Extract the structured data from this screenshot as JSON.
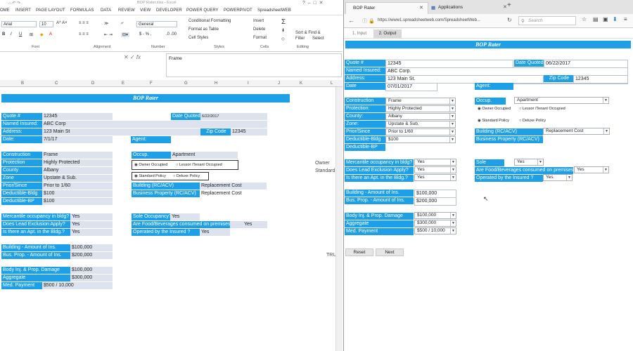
{
  "excel": {
    "title_center": "BOP Rater.xlsx - Excel",
    "tabs": [
      "OME",
      "INSERT",
      "PAGE LAYOUT",
      "FORMULAS",
      "DATA",
      "REVIEW",
      "VIEW",
      "DEVELOPER",
      "POWER QUERY",
      "POWERPIVOT",
      "SpreadsheetWEB"
    ],
    "font_name": "Arial",
    "font_size": "10",
    "number_format": "General",
    "styles_items": [
      "Conditional Formatting",
      "Format as Table",
      "Cell Styles"
    ],
    "cells_items": [
      "Insert",
      "Delete",
      "Format"
    ],
    "editing_items": [
      "Sort & Find &",
      "Filter",
      "Select"
    ],
    "groups": [
      "Font",
      "Alignment",
      "Number",
      "Styles",
      "Cells",
      "Editing"
    ],
    "formula_value": "Frame",
    "columns": [
      "B",
      "C",
      "D",
      "E",
      "F",
      "G",
      "H",
      "I",
      "J",
      "K",
      "L"
    ],
    "sheet_title": "BOP Rater",
    "quote_label": "Quote #",
    "quote_value": "12345",
    "date_quoted_label": "Date Quoted",
    "date_quoted_value": "6/22/2017",
    "named_insured_label": "Named Insured:",
    "named_insured_value": "ABC Corp",
    "address_label": "Address:",
    "address_value": "123 Main St",
    "zip_label": "Zip Code",
    "zip_value": "12345",
    "date_label": "Date:",
    "date_value": "7/1/17",
    "agent_label": "Agent:",
    "construction_label": "Construction",
    "construction_value": "Frame",
    "protection_label": "Protection",
    "protection_value": "Highly Protected",
    "county_label": "County",
    "county_value": "Albany",
    "zone_label": "Zone",
    "zone_value": "Upstate & Sub.",
    "prior_since_label": "Prior/Since",
    "prior_since_value": "Prior to 1/60",
    "deductible_bldg_label": "Deductible-Bldg",
    "deductible_bldg_value": "$100",
    "deductible_bp_label": "Deductible-BP",
    "deductible_bp_value": "$100",
    "occup_label": "Occup.",
    "occup_value": "Apartment",
    "owner_occupied": "Owner Occupied",
    "lessor_tenant": "Lessor /Tenant Occupied",
    "standard_policy": "Standard Policy",
    "deluxe_policy": "Deluxe Policy",
    "building_rcacv_label": "Building (RC/ACV)",
    "building_rcacv_value": "Replacement Cost",
    "bp_rcacv_label": "Business Property (RC/ACV)",
    "bp_rcacv_value": "Replacement Cost",
    "side_owner": "Owner",
    "side_standard": "Standard",
    "mercantile_label": "Mercantile occupancy in bldg?",
    "mercantile_value": "Yes",
    "lead_label": "Does Lead Exclusion Apply?",
    "lead_value": "Yes",
    "apt_label": "Is there an Apt. in the Bldg.?",
    "apt_value": "Yes",
    "sole_label": "Sole Occupancy?",
    "sole_value": "Yes",
    "food_label": "Are Food/Beverages consumed on premises?",
    "food_value": "Yes",
    "operated_label": "Operated by the Insured ?",
    "operated_value": "Yes",
    "building_amt_label": "Building - Amount of Ins.",
    "building_amt_value": "$100,000",
    "bus_prop_label": "Bus. Prop. - Amount of Ins.",
    "bus_prop_value": "$200,000",
    "tru_text": "TRU",
    "bi_label": "Body Inj. & Prop. Damage",
    "bi_value": "$100,000",
    "aggregate_label": "Aggregate",
    "aggregate_value": "$300,000",
    "med_label": "Med. Payment",
    "med_value": "$500 / 10,000"
  },
  "browser": {
    "tab1": "BOP Rater",
    "tab2": "Applications",
    "new_tab": "+",
    "url": "https://www1.spreadsheetweb.com/SpreadsheetWeb...",
    "search_placeholder": "Search",
    "page_tab_input": "1. Input",
    "page_tab_output": "2. Output",
    "title": "BOP Rater",
    "quote_label": "Quote #",
    "quote_value": "12345",
    "date_quoted_label": "Date Quoted",
    "date_quoted_value": "06/22/2017",
    "named_insured_label": "Named Insured:",
    "named_insured_value": "ABC Corp.",
    "address_label": "Address:",
    "address_value": "123 Main St.",
    "zip_label": "Zip Code",
    "zip_value": "12345",
    "date_label": "Date",
    "date_value": "07/01/2017",
    "agent_label": "Agent:",
    "construction_label": "Construction",
    "construction_value": "Frame",
    "protection_label": "Protection:",
    "protection_value": "Highly Protected",
    "county_label": "County:",
    "county_value": "Albany",
    "zone_label": "Zone:",
    "zone_value": "Upstate & Sub.",
    "prior_since_label": "Prior/Since",
    "prior_since_value": "Prior to 1/60",
    "deductible_bldg_label": "Deductible-Bldg",
    "deductible_bldg_value": "$100",
    "deductible_bp_label": "Deductible-BP",
    "occup_label": "Occup.",
    "occup_value": "Apartment",
    "owner_occupied": "Owner Occupied",
    "lessor_tenant": "Lessor /Tenant Occupied",
    "standard_policy": "Standard Policy",
    "deluxe_policy": "Deluxe Policy",
    "building_rcacv_label": "Building (RC/ACV)",
    "building_rcacv_value": "Replacement Cost",
    "bp_rcacv_label": "Business Property (RC/ACV)",
    "mercantile_label": "Mercantile occupancy in bldg?",
    "mercantile_value": "Yes",
    "lead_label": "Does Lead Exclusion Apply?",
    "lead_value": "Yes",
    "apt_label": "Is there an Apt. in the Bldg.?",
    "apt_value": "Yes",
    "sole_label": "Sole",
    "sole_value": "Yes",
    "food_label": "Are Food/Beverages consumed on premises?",
    "food_value": "Yes",
    "operated_label": "Operated by the Insured ?",
    "operated_value": "Yes",
    "building_amt_label": "Building - Amount of Ins.",
    "building_amt_value": "$100,000",
    "bus_prop_label": "Bus. Prop. - Amount of Ins.",
    "bus_prop_value": "$200,000",
    "bi_label": "Body Inj. & Prop. Damage",
    "bi_value": "$100,000",
    "aggregate_label": "Aggregate",
    "aggregate_value": "$300,000",
    "med_label": "Med. Payment",
    "med_value": "$500 / 10,000",
    "reset_label": "Reset",
    "next_label": "Next"
  }
}
